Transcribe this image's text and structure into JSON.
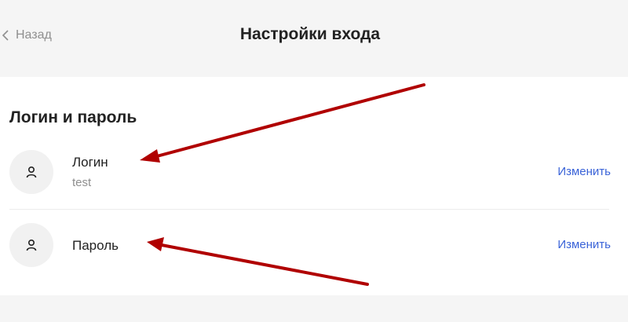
{
  "header": {
    "back_label": "Назад",
    "title": "Настройки входа"
  },
  "section": {
    "title": "Логин и пароль",
    "items": [
      {
        "label": "Логин",
        "value": "test",
        "action": "Изменить",
        "icon": "user-icon"
      },
      {
        "label": "Пароль",
        "action": "Изменить",
        "icon": "user-icon"
      }
    ]
  },
  "colors": {
    "link": "#3a63d8",
    "arrow": "#b00000",
    "background": "#f5f5f5",
    "card": "#ffffff"
  }
}
